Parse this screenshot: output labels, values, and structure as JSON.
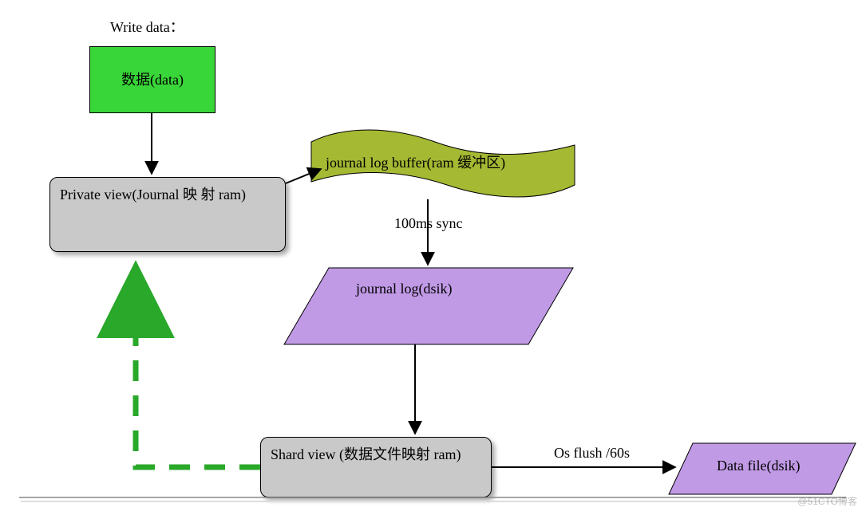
{
  "title": "Write data：",
  "nodes": {
    "data": "数据(data)",
    "private_view": "Private view(Journal 映 射 ram)",
    "journal_buffer": "journal log buffer(ram 缓冲区)",
    "journal_disk": "journal log(dsik)",
    "shard_view": "Shard view (数据文件映射 ram)",
    "data_file": "Data file(dsik)"
  },
  "edges": {
    "sync": "100ms sync",
    "flush": "Os flush /60s"
  },
  "watermark": "@51CTO博客"
}
